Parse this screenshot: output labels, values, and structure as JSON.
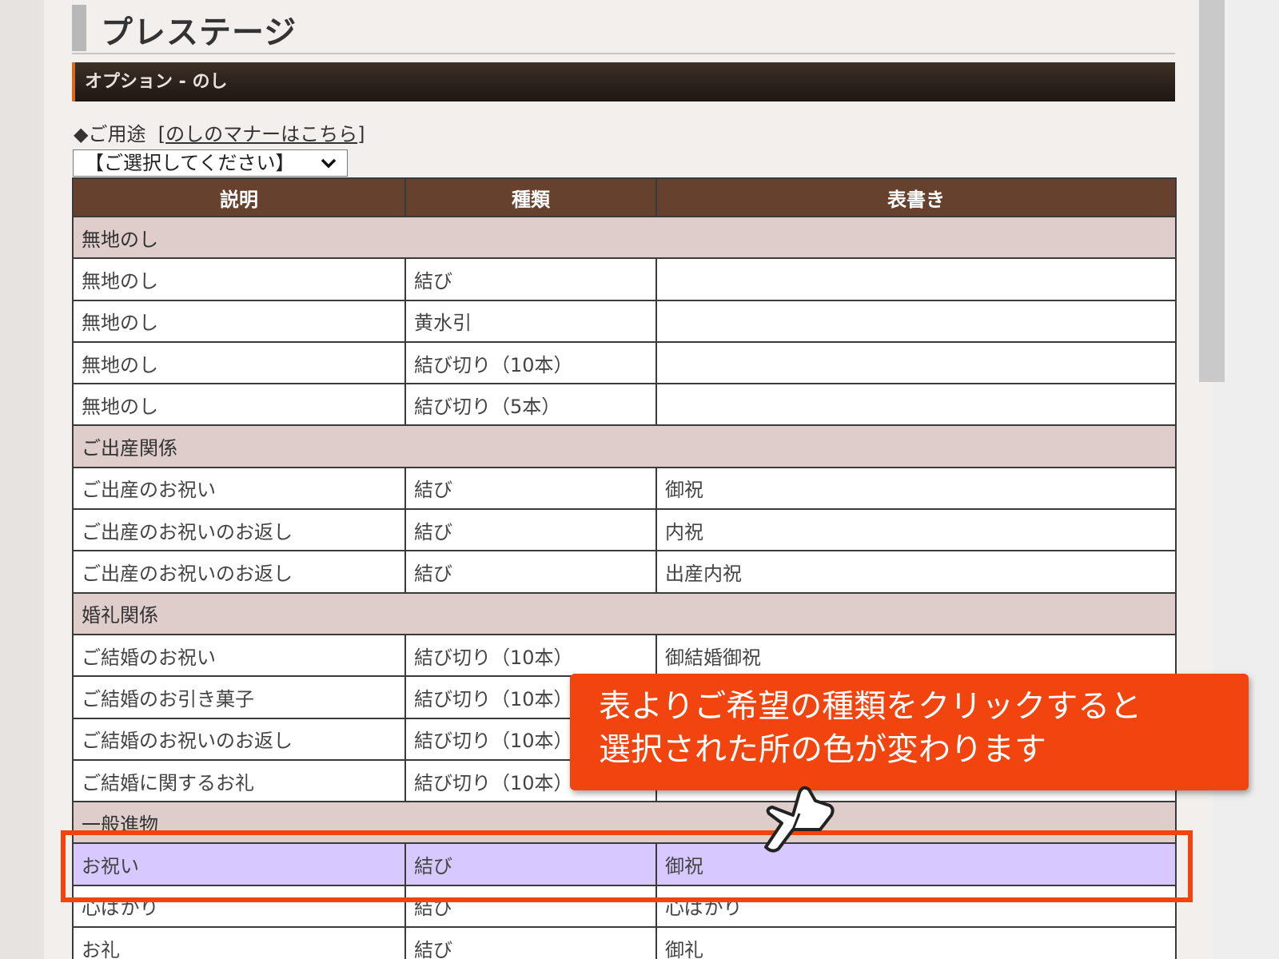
{
  "page": {
    "title": "プレステージ",
    "section_header": "オプション - のし"
  },
  "usage": {
    "label": "◆ご用途",
    "link_open": "[",
    "link_text": "のしのマナーはこちら",
    "link_close": "]",
    "select_value": "【ご選択してください】"
  },
  "table": {
    "headers": [
      "説明",
      "種類",
      "表書き"
    ],
    "rows": [
      {
        "group": "無地のし"
      },
      {
        "desc": "無地のし",
        "type": "結び",
        "label": ""
      },
      {
        "desc": "無地のし",
        "type": "黄水引",
        "label": ""
      },
      {
        "desc": "無地のし",
        "type": "結び切り（10本）",
        "label": ""
      },
      {
        "desc": "無地のし",
        "type": "結び切り（5本）",
        "label": ""
      },
      {
        "group": "ご出産関係"
      },
      {
        "desc": "ご出産のお祝い",
        "type": "結び",
        "label": "御祝"
      },
      {
        "desc": "ご出産のお祝いのお返し",
        "type": "結び",
        "label": "内祝"
      },
      {
        "desc": "ご出産のお祝いのお返し",
        "type": "結び",
        "label": "出産内祝"
      },
      {
        "group": "婚礼関係"
      },
      {
        "desc": "ご結婚のお祝い",
        "type": "結び切り（10本）",
        "label": "御結婚御祝"
      },
      {
        "desc": "ご結婚のお引き菓子",
        "type": "結び切り（10本）",
        "label": ""
      },
      {
        "desc": "ご結婚のお祝いのお返し",
        "type": "結び切り（10本）",
        "label": ""
      },
      {
        "desc": "ご結婚に関するお礼",
        "type": "結び切り（10本）",
        "label": ""
      },
      {
        "group": "一般進物"
      },
      {
        "desc": "お祝い",
        "type": "結び",
        "label": "御祝",
        "selected": true
      },
      {
        "desc": "心ばかり",
        "type": "結び",
        "label": "心ばかり"
      },
      {
        "desc": "お礼",
        "type": "結び",
        "label": "御礼"
      }
    ]
  },
  "callout": {
    "line1": "表よりご希望の種類をクリックすると",
    "line2": "選択された所の色が変わります"
  },
  "colors": {
    "accent": "#f2440e",
    "header_bg": "#66412e",
    "group_bg": "#dfcdcc",
    "selected_bg": "#d7c9ff"
  }
}
